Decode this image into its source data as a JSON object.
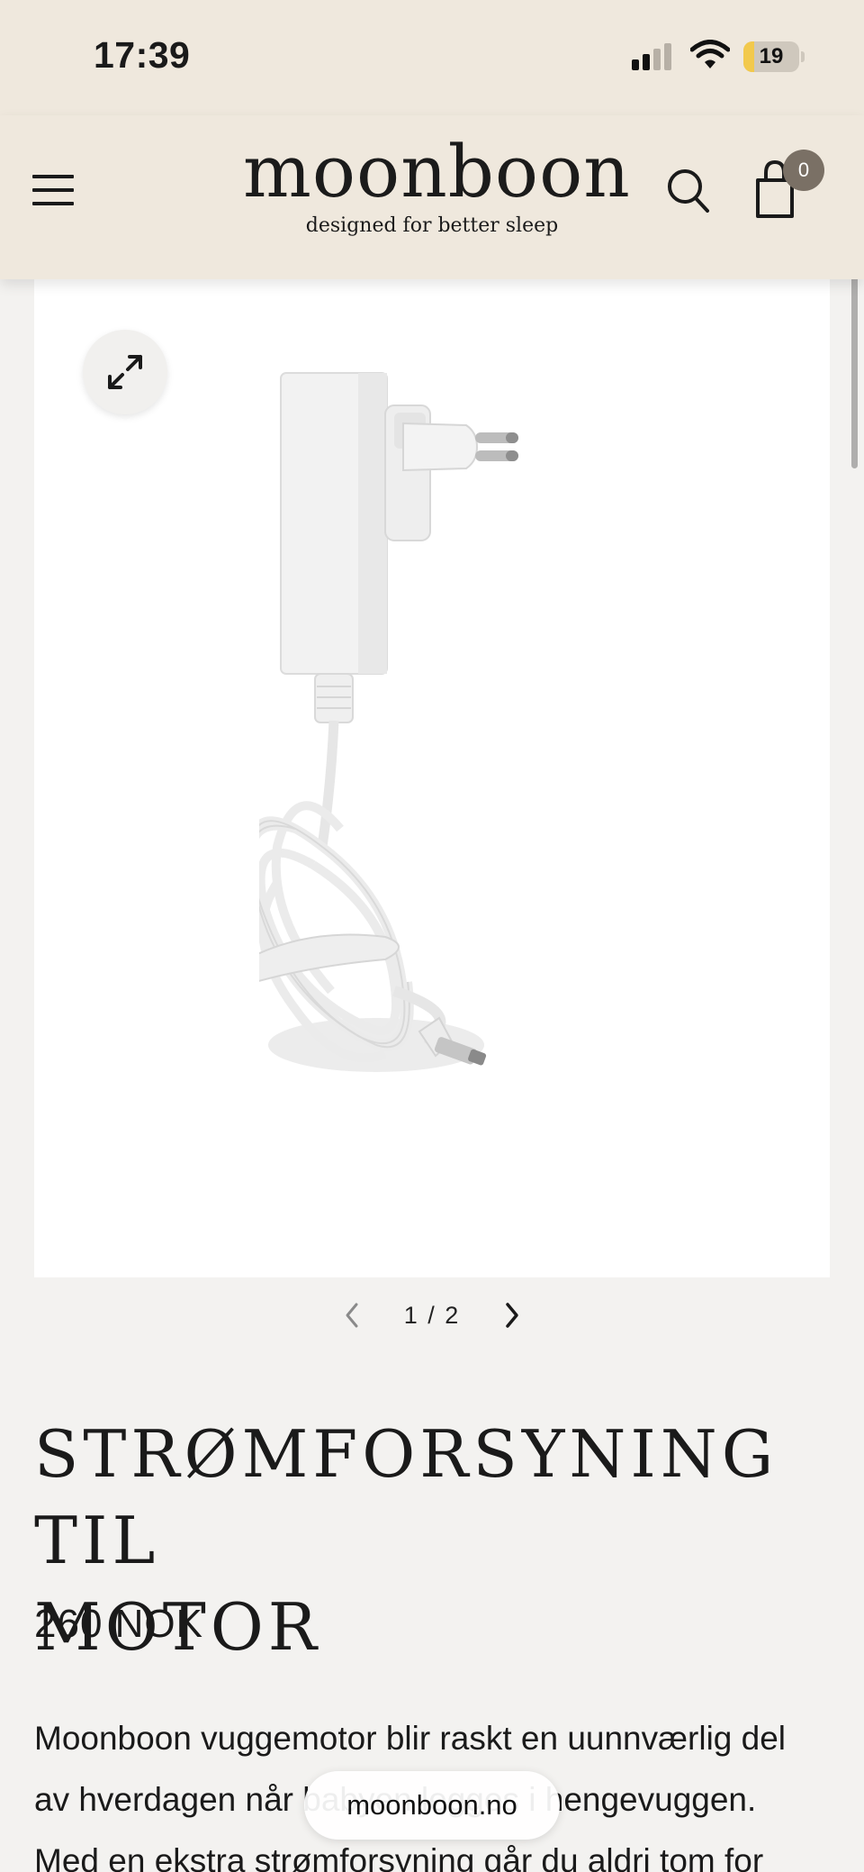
{
  "status_bar": {
    "time": "17:39",
    "battery_level": "19",
    "battery_fraction": 0.19,
    "battery_color": "#f2c94c",
    "icons": [
      "signal-icon",
      "wifi-icon",
      "battery-icon"
    ]
  },
  "header": {
    "brand": "moonboon",
    "tagline": "designed for better sleep",
    "cart_count": "0",
    "icons": [
      "hamburger-menu-icon",
      "search-icon",
      "shopping-bag-icon"
    ],
    "background_color": "#efe8dd"
  },
  "gallery": {
    "current": "1",
    "total": "2",
    "separator": "/",
    "image_subject": "white power adapter with coiled cable",
    "icons": [
      "expand-icon",
      "chevron-left-icon",
      "chevron-right-icon"
    ]
  },
  "product": {
    "title_line1": "STRØMFORSYNING TIL",
    "title_line2": "MOTOR",
    "price": "260 NOK",
    "description_lines": [
      "Moonboon vuggemotor blir raskt en uunnværlig del",
      "av hverdagen når babyen legges i hengevuggen.",
      "Med en ekstra strømforsyning går du aldri tom for"
    ]
  },
  "browser": {
    "url": "moonboon.no"
  }
}
